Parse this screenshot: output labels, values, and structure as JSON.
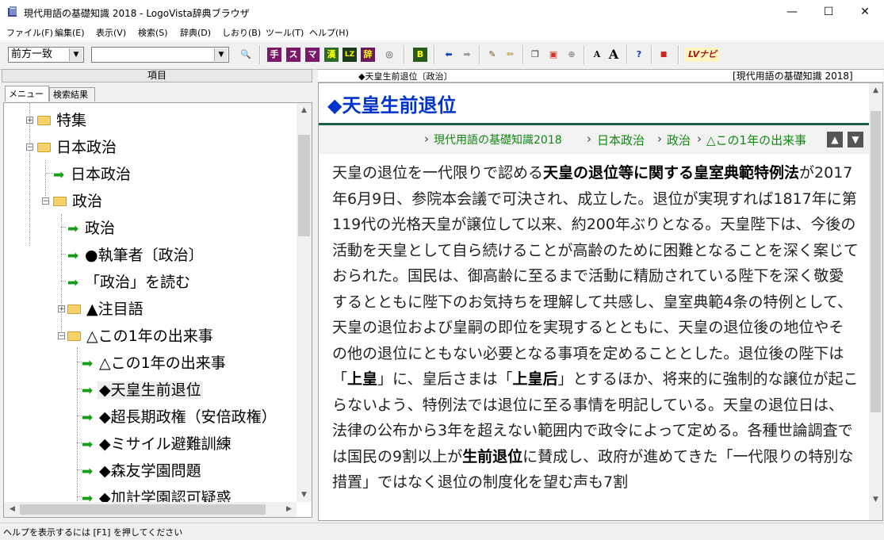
{
  "window": {
    "title": "現代用語の基礎知識 2018 - LogoVista辞典ブラウザ",
    "minimize_glyph": "—",
    "maximize_glyph": "☐",
    "close_glyph": "✕"
  },
  "menu": [
    "ファイル(F)",
    "編集(E)",
    "表示(V)",
    "検索(S)",
    "辞典(D)",
    "しおり(B)",
    "ツール(T)",
    "ヘルプ(H)"
  ],
  "toolbar": {
    "search_mode": "前方一致",
    "search_value": "",
    "buttons": {
      "binoculars": "🔍",
      "te": "手",
      "su": "ス",
      "ma": "マ",
      "kan": "漢",
      "latin": "LZ",
      "dic": "辞",
      "globe": "◎",
      "b": "B",
      "back": "⬅",
      "forward": "➡",
      "pen1": "✎",
      "pen2": "✏",
      "copy": "❐",
      "paste": "▣",
      "zoom": "⊕",
      "font_small": "A",
      "font_large": "A",
      "help": "?",
      "lock": "■",
      "lv_navi": "LVナビ"
    }
  },
  "left_pane": {
    "header": "項目",
    "tabs": [
      "メニュー",
      "検索結果"
    ],
    "tree": [
      {
        "label": "特集",
        "type": "folder",
        "expander": "+"
      },
      {
        "label": "日本政治",
        "type": "folder",
        "expander": "−"
      },
      {
        "label": "日本政治",
        "type": "leaf"
      },
      {
        "label": "政治",
        "type": "folder",
        "expander": "−"
      },
      {
        "label": "政治",
        "type": "leaf"
      },
      {
        "label": "●執筆者〔政治〕",
        "type": "leaf"
      },
      {
        "label": "「政治」を読む",
        "type": "leaf"
      },
      {
        "label": "▲注目語",
        "type": "folder",
        "expander": "+"
      },
      {
        "label": "△この1年の出来事",
        "type": "folder",
        "expander": "−"
      },
      {
        "label": "△この1年の出来事",
        "type": "leaf"
      },
      {
        "label": "◆天皇生前退位",
        "type": "leaf",
        "selected": true
      },
      {
        "label": "◆超長期政権（安倍政権）",
        "type": "leaf"
      },
      {
        "label": "◆ミサイル避難訓練",
        "type": "leaf"
      },
      {
        "label": "◆森友学園問題",
        "type": "leaf"
      },
      {
        "label": "◆加計学園認可疑惑",
        "type": "leaf"
      }
    ]
  },
  "right_pane": {
    "entry_title_small": "◆天皇生前退位〔政治〕",
    "source": "[現代用語の基礎知識 2018]",
    "heading": "◆天皇生前退位",
    "breadcrumb": [
      "現代用語の基礎知識2018",
      "日本政治",
      "政治",
      "△この1年の出来事"
    ],
    "body_segments": [
      {
        "t": "天皇の退位を一代限りで認める",
        "b": false
      },
      {
        "t": "天皇の退位等に関する皇室典範特例法",
        "b": true
      },
      {
        "t": "が2017年6月9日、参院本会議で可決され、成立した。退位が実現すれば1817年に第119代の光格天皇が譲位して以来、約200年ぶりとなる。天皇陛下は、今後の活動を天皇として自ら続けることが高齢のために困難となることを深く案じておられた。国民は、御高齢に至るまで活動に精励されている陛下を深く敬愛するとともに陛下のお気持ちを理解して共感し、皇室典範4条の特例として、天皇の退位および皇嗣の即位を実現するとともに、天皇の退位後の地位やその他の退位にともない必要となる事項を定めることとした。退位後の陛下は「",
        "b": false
      },
      {
        "t": "上皇",
        "b": true
      },
      {
        "t": "」に、皇后さまは「",
        "b": false
      },
      {
        "t": "上皇后",
        "b": true
      },
      {
        "t": "」とするほか、将来的に強制的な譲位が起こらないよう、特例法では退位に至る事情を明記している。天皇の退位日は、法律の公布から3年を超えない範囲内で政令によって定める。各種世論調査では国民の9割以上が",
        "b": false
      },
      {
        "t": "生前退位",
        "b": true
      },
      {
        "t": "に賛成し、政府が進めてきた「一代限りの特別な措置」ではなく退位の制度化を望む声も7割",
        "b": false
      }
    ]
  },
  "status_bar": "ヘルプを表示するには [F1] を押してください"
}
